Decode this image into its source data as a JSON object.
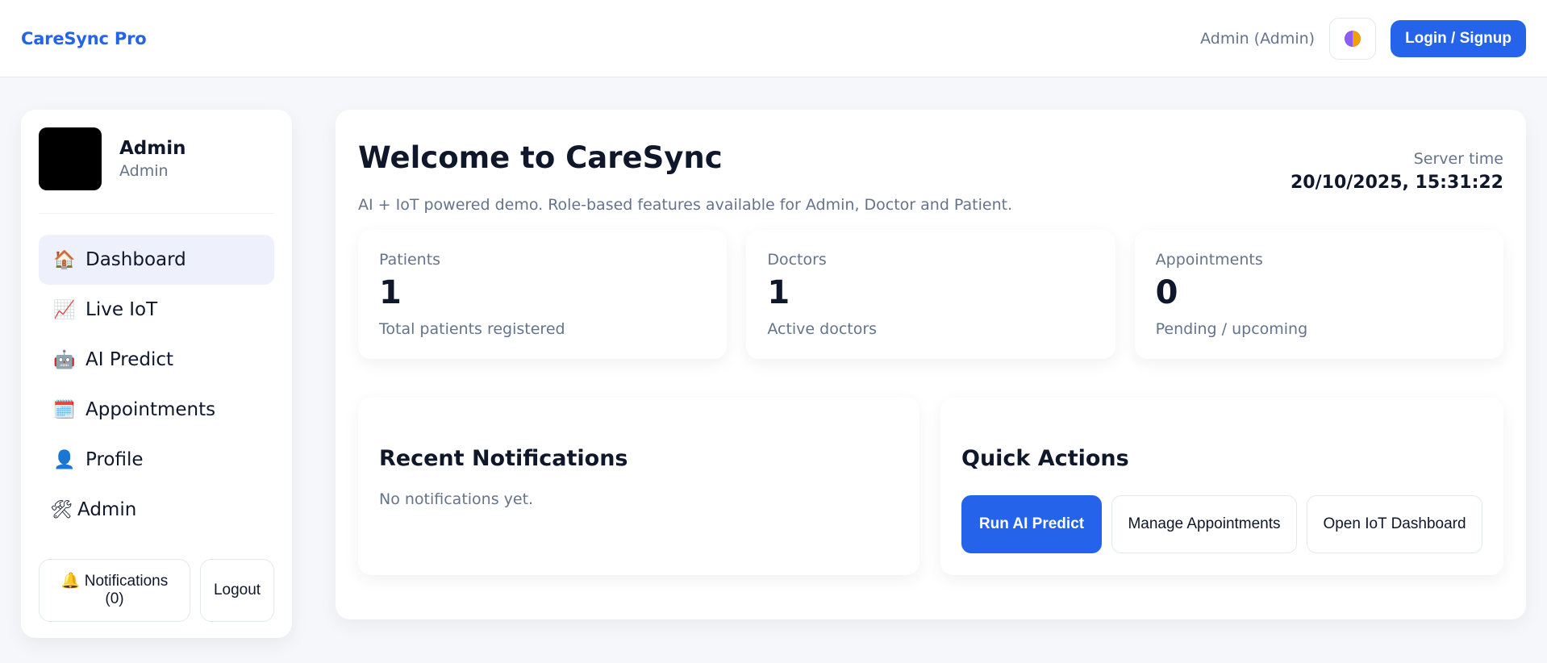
{
  "header": {
    "brand": "CareSync Pro",
    "user_label": "Admin (Admin)",
    "theme_icon": "theme-toggle-icon",
    "login_label": "Login / Signup"
  },
  "sidebar": {
    "profile": {
      "name": "Admin",
      "role": "Admin"
    },
    "items": [
      {
        "icon": "🏠",
        "label": "Dashboard",
        "active": true
      },
      {
        "icon": "📈",
        "label": "Live IoT"
      },
      {
        "icon": "🤖",
        "label": "AI Predict"
      },
      {
        "icon": "🗓️",
        "label": "Appointments"
      },
      {
        "icon": "👤",
        "label": "Profile"
      },
      {
        "icon": "🛠",
        "label": "Admin"
      }
    ],
    "notifications_icon": "🔔",
    "notifications_label": "Notifications",
    "notifications_count": "(0)",
    "logout_label": "Logout"
  },
  "main": {
    "title": "Welcome to CareSync",
    "subtitle": "AI + IoT powered demo. Role-based features available for Admin, Doctor and Patient.",
    "server_label": "Server time",
    "server_time": "20/10/2025, 15:31:22",
    "stats": [
      {
        "label": "Patients",
        "value": "1",
        "desc": "Total patients registered"
      },
      {
        "label": "Doctors",
        "value": "1",
        "desc": "Active doctors"
      },
      {
        "label": "Appointments",
        "value": "0",
        "desc": "Pending / upcoming"
      }
    ],
    "notifications": {
      "title": "Recent Notifications",
      "empty": "No notifications yet."
    },
    "quick_actions": {
      "title": "Quick Actions",
      "buttons": [
        "Run AI Predict",
        "Manage Appointments",
        "Open IoT Dashboard"
      ]
    }
  },
  "colors": {
    "accent": "#2563eb",
    "active_nav": "#eef0fb",
    "muted": "#64748b"
  }
}
